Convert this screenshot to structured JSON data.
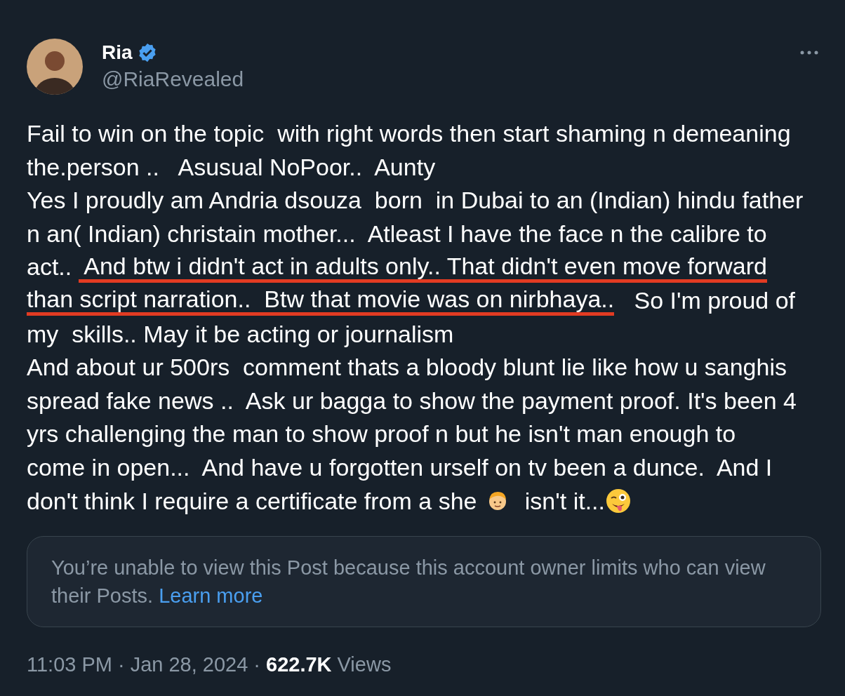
{
  "author": {
    "name": "Ria",
    "verified": true,
    "handle": "@RiaRevealed"
  },
  "post_lines": [
    [
      {
        "kind": "text",
        "text": "Fail to win on the topic  with right words then start shaming n demeaning",
        "underlined": false
      }
    ],
    [
      {
        "kind": "text",
        "text": "the.person ..   Asusual NoPoor..  Aunty",
        "underlined": false
      }
    ],
    [
      {
        "kind": "text",
        "text": "Yes I proudly am Andria dsouza  born  in Dubai to an (Indian) hindu father",
        "underlined": false
      }
    ],
    [
      {
        "kind": "text",
        "text": "n an( Indian) christain mother...  Atleast I have the face n the calibre to",
        "underlined": false
      }
    ],
    [
      {
        "kind": "text",
        "text": "act.. ",
        "underlined": false
      },
      {
        "kind": "text",
        "text": " And btw i didn't act in adults only.. That didn't even move forward",
        "underlined": true
      }
    ],
    [
      {
        "kind": "text",
        "text": "than script narration..  Btw that movie was on nirbhaya..",
        "underlined": true
      },
      {
        "kind": "text",
        "text": "   So I'm proud of",
        "underlined": false
      }
    ],
    [
      {
        "kind": "text",
        "text": "my  skills.. May it be acting or journalism",
        "underlined": false
      }
    ],
    [
      {
        "kind": "text",
        "text": "And about ur 500rs  comment thats a bloody blunt lie like how u sanghis",
        "underlined": false
      }
    ],
    [
      {
        "kind": "text",
        "text": "spread fake news ..  Ask ur bagga to show the payment proof. It's been 4",
        "underlined": false
      }
    ],
    [
      {
        "kind": "text",
        "text": "yrs challenging the man to show proof n but he isn't man enough to",
        "underlined": false
      }
    ],
    [
      {
        "kind": "text",
        "text": "come in open...  And have u forgotten urself on tv been a dunce.  And I",
        "underlined": false
      }
    ],
    [
      {
        "kind": "text",
        "text": "don't think I require a certificate from a she ",
        "underlined": false
      },
      {
        "kind": "boy-emoji"
      },
      {
        "kind": "text",
        "text": "  isn't it...",
        "underlined": false
      },
      {
        "kind": "wink-emoji"
      }
    ]
  ],
  "notice": {
    "text": "You’re unable to view this Post because this account owner limits who can view their Posts.",
    "link": "Learn more"
  },
  "footer": {
    "time": "11:03 PM",
    "separator_1": "·",
    "date": "Jan 28, 2024",
    "separator_2": "·",
    "views_count": "622.7K",
    "views_label": "Views"
  }
}
